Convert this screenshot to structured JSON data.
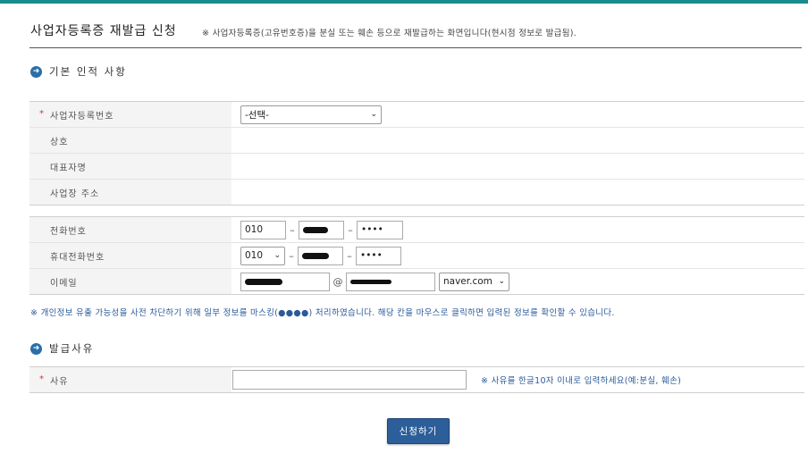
{
  "header": {
    "title": "사업자등록증 재발급 신청",
    "description": "※ 사업자등록증(고유번호증)을 분실 또는 훼손 등으로 재발급하는 화면입니다(현시점 정보로 발급됨)."
  },
  "section_basic": {
    "label": "기본 인적 사항",
    "fields": {
      "biz_no_label": "사업자등록번호",
      "biz_no_value": "-선택-",
      "company_label": "상호",
      "rep_label": "대표자명",
      "addr_label": "사업장 주소"
    }
  },
  "section_contact": {
    "phone_label": "전화번호",
    "phone_first": "010",
    "phone_last": "••••",
    "mobile_label": "휴대전화번호",
    "mobile_first": "010",
    "mobile_last": "••••",
    "email_label": "이메일",
    "email_at": "@",
    "email_domain": "naver.com"
  },
  "notice": "※ 개인정보 유출 가능성을 사전 차단하기 위해 일부 정보를 마스킹(●●●●) 처리하였습니다. 해당 칸을 마우스로 클릭하면 입력된 정보를 확인할 수 있습니다.",
  "section_reason": {
    "label": "발급사유",
    "reason_label": "사유",
    "reason_hint": "※ 사유를 한글10자 이내로 입력하세요(예:분실, 훼손)"
  },
  "submit_label": "신청하기",
  "icons": {
    "section": "arrow-right-circle-icon",
    "dropdown": "chevron-down-icon"
  },
  "colors": {
    "accent_bar": "#1b8c8c",
    "button": "#2c5e9a",
    "notice_text": "#2a5a9a",
    "required": "#dd3333"
  }
}
